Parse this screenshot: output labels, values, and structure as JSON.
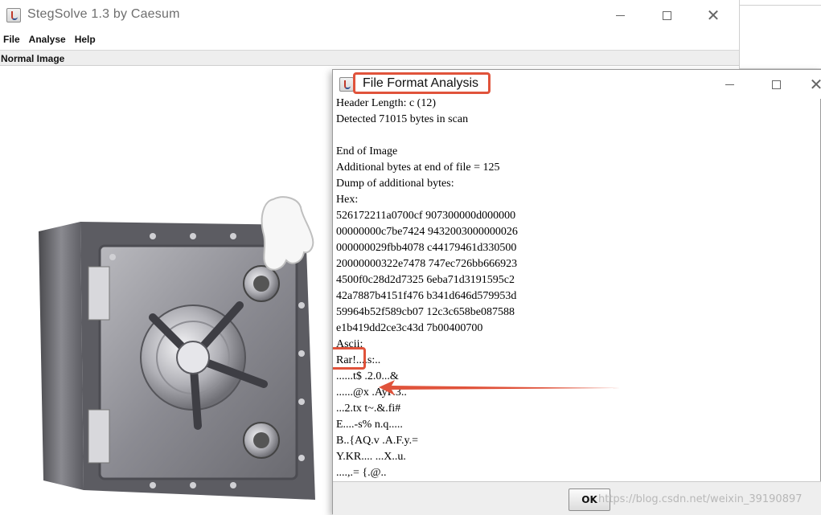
{
  "main_window": {
    "title": "StegSolve 1.3 by Caesum",
    "menu": [
      "File",
      "Analyse",
      "Help"
    ],
    "image_label": "Normal Image"
  },
  "dialog": {
    "title": "File Format Analysis",
    "lines": [
      "Header Length: c (12)",
      "Detected 71015 bytes in scan",
      "",
      "End of Image",
      "Additional bytes at end of file = 125",
      "Dump of additional bytes:",
      "Hex:",
      "526172211a0700cf 907300000d000000",
      "00000000c7be7424 9432003000000026",
      "000000029fbb4078 c44179461d330500",
      "20000000322e7478 747ec726bb666923",
      "4500f0c28d2d7325 6eba71d3191595c2",
      "42a7887b4151f476 b341d646d579953d",
      "59964b52f589cb07 12c3c658be087588",
      "e1b419dd2ce3c43d 7b00400700",
      "Ascii:",
      "Rar!....s:..",
      "......t$ .2.0...&",
      "......@x .AyF.3..",
      "...2.tx t~.&.fi#",
      "E....-s% n.q.....",
      "B..{AQ.v .A.F.y.=",
      "Y.KR.... ...X..u.",
      "....,.= {.@.."
    ],
    "ok_label": "OK",
    "watermark": "https://blog.csdn.net/weixin_39190897"
  },
  "colors": {
    "highlight_red": "#e0533b",
    "dialog_footer_bg": "#eeeeee",
    "image_label_bg": "#eeeeee"
  }
}
